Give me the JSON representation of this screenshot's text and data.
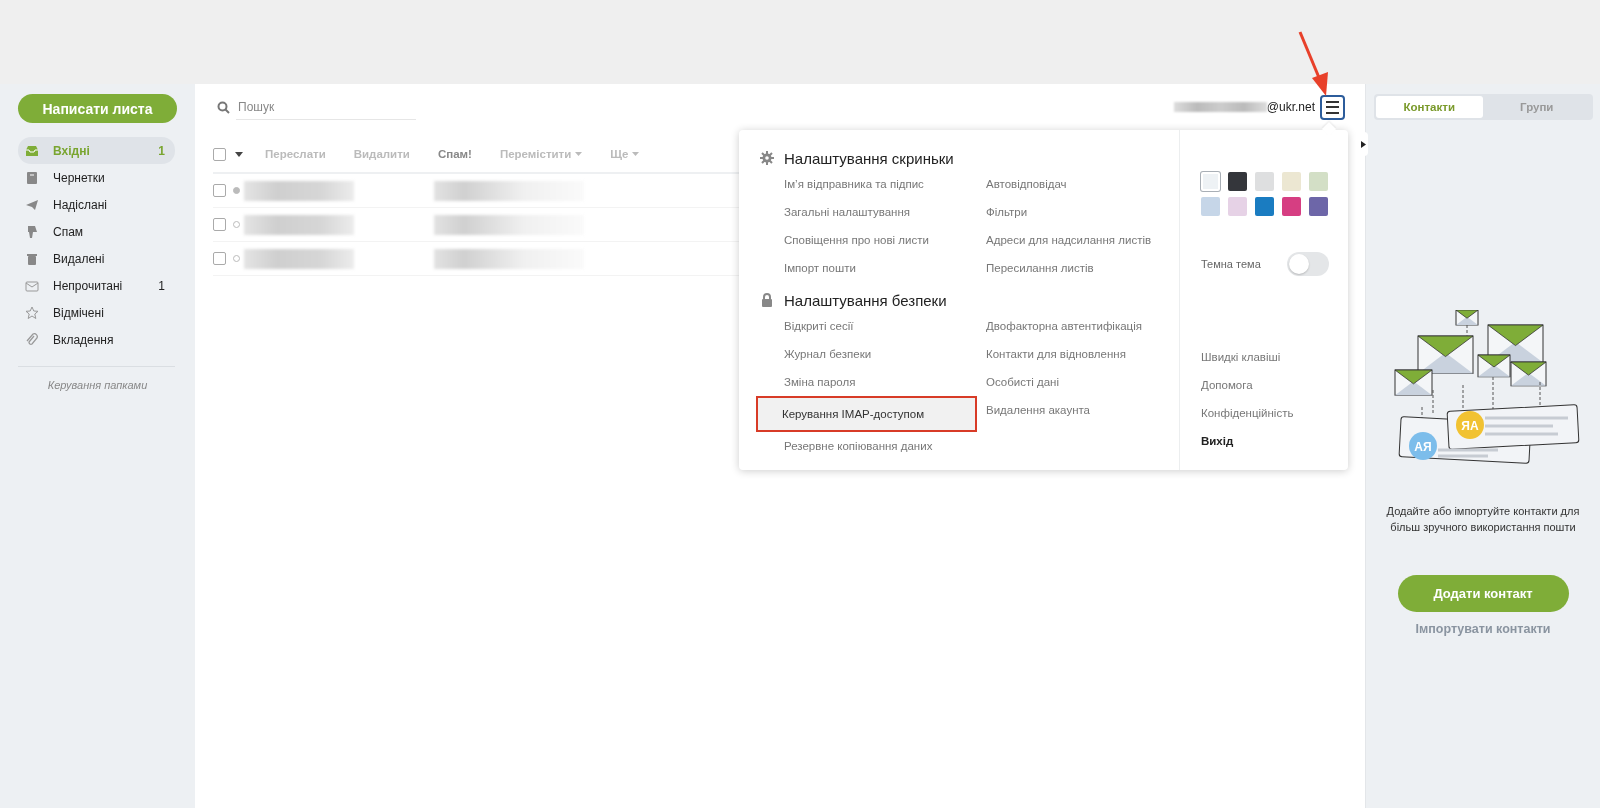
{
  "sidebar": {
    "compose_button": "Написати листа",
    "folders": [
      {
        "label": "Вхідні",
        "count": "1",
        "selected": true
      },
      {
        "label": "Чернетки",
        "selected": false
      },
      {
        "label": "Надіслані",
        "selected": false
      },
      {
        "label": "Спам",
        "selected": false
      },
      {
        "label": "Видалені",
        "selected": false
      },
      {
        "label": "Непрочитані",
        "count": "1",
        "selected": false
      },
      {
        "label": "Відмічені",
        "selected": false
      },
      {
        "label": "Вкладення",
        "selected": false
      }
    ],
    "manage_link": "Керування папками"
  },
  "search": {
    "placeholder": "Пошук"
  },
  "toolbar": {
    "select_all": {
      "checked": false
    },
    "actions": [
      {
        "label": "Переслати",
        "disabled": true,
        "has_menu": false
      },
      {
        "label": "Видалити",
        "disabled": true,
        "has_menu": false
      },
      {
        "label": "Спам!",
        "disabled": false,
        "has_menu": false
      },
      {
        "label": "Перемістити",
        "disabled": true,
        "has_menu": true
      },
      {
        "label": "Ще",
        "disabled": true,
        "has_menu": true
      }
    ]
  },
  "messages": [
    {
      "unread": true,
      "checked": false
    },
    {
      "unread": false,
      "checked": false
    },
    {
      "unread": false,
      "checked": false
    }
  ],
  "account": {
    "email_suffix": "@ukr.net"
  },
  "menu": {
    "sections": [
      {
        "title": "Налаштування скриньки",
        "columns": [
          [
            {
              "label": "Ім’я відправника та підпис",
              "annotated": false
            },
            {
              "label": "Загальні налаштування",
              "annotated": false
            },
            {
              "label": "Сповіщення про нові листи",
              "annotated": false
            },
            {
              "label": "Імпорт пошти",
              "annotated": false
            }
          ],
          [
            {
              "label": "Автовідповідач",
              "annotated": false
            },
            {
              "label": "Фільтри",
              "annotated": false
            },
            {
              "label": "Адреси для надсилання листів",
              "annotated": false
            },
            {
              "label": "Пересилання листів",
              "annotated": false
            }
          ]
        ]
      },
      {
        "title": "Налаштування безпеки",
        "columns": [
          [
            {
              "label": "Відкриті сесії",
              "annotated": false
            },
            {
              "label": "Журнал безпеки",
              "annotated": false
            },
            {
              "label": "Зміна пароля",
              "annotated": false
            },
            {
              "label": "Керування IMAP-доступом",
              "annotated": true
            },
            {
              "label": "Резервне копіювання даних",
              "annotated": false
            }
          ],
          [
            {
              "label": "Двофакторна автентифікація",
              "annotated": false
            },
            {
              "label": "Контакти для відновлення",
              "annotated": false
            },
            {
              "label": "Особисті дані",
              "annotated": false
            },
            {
              "label": "Видалення акаунта",
              "annotated": false
            }
          ]
        ]
      }
    ],
    "themes": [
      {
        "color": "#eef2f5",
        "selected": true
      },
      {
        "color": "#34363b",
        "selected": false
      },
      {
        "color": "#dedfe0",
        "selected": false
      },
      {
        "color": "#ece7d2",
        "selected": false
      },
      {
        "color": "#d3dfc6",
        "selected": false
      },
      {
        "color": "#c6d6e8",
        "selected": false
      },
      {
        "color": "#e6d2e6",
        "selected": false
      },
      {
        "color": "#1a7cc1",
        "selected": false
      },
      {
        "color": "#d63e82",
        "selected": false
      },
      {
        "color": "#6d66a8",
        "selected": false
      }
    ],
    "dark_theme": {
      "label": "Темна тема",
      "on": false
    },
    "links": [
      {
        "label": "Швидкі клавіші",
        "kind": "link"
      },
      {
        "label": "Допомога",
        "kind": "link"
      },
      {
        "label": "Конфіденційність",
        "kind": "link"
      },
      {
        "label": "Вихід",
        "kind": "logout"
      }
    ]
  },
  "annotation_arrow": true,
  "contacts_panel": {
    "tabs": [
      {
        "label": "Контакти",
        "selected": true
      },
      {
        "label": "Групи",
        "selected": false
      }
    ],
    "avatars": [
      "АЯ",
      "ЯА"
    ],
    "message": "Додайте або імпортуйте контакти для більш зручного використання пошти",
    "add_button": "Додати контакт",
    "import_link": "Імпортувати контакти"
  }
}
